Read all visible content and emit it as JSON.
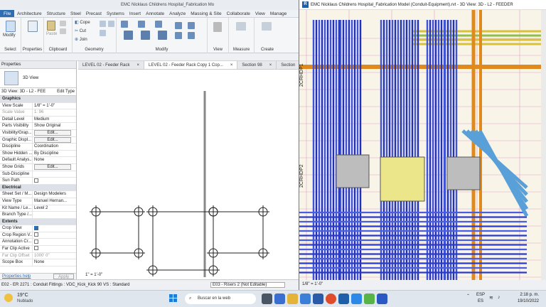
{
  "left_window": {
    "title": "EMC Nicklaus Childrens Hospital_Fabrication Mo",
    "menu": [
      "File",
      "Architecture",
      "Structure",
      "Steel",
      "Precast",
      "Systems",
      "Insert",
      "Annotate",
      "Analyze",
      "Massing & Site",
      "Collaborate",
      "View",
      "Manage"
    ],
    "ribbon": {
      "modify": "Modify",
      "paste": "Paste",
      "cope": "Cope",
      "cut": "Cut",
      "join": "Join",
      "groups": [
        "Select",
        "Properties",
        "Clipboard",
        "Geometry",
        "Modify",
        "View",
        "Measure",
        "Create"
      ]
    },
    "tabs": [
      "LEVEL 02 - Feeder Rack",
      "LEVEL 02 - Feeder Rack Copy 1 Cop...",
      "Section 98",
      "Section"
    ],
    "properties": {
      "header": "Properties",
      "type_name": "3D View",
      "selector": "3D View: 3D - L2 - FEE",
      "edit_type": "Edit Type",
      "rows": [
        {
          "k": "Graphics",
          "v": "",
          "section": true
        },
        {
          "k": "View Scale",
          "v": "1/8\" = 1'-0\""
        },
        {
          "k": "Scale Value",
          "v": "1: 96",
          "dim": true
        },
        {
          "k": "Detail Level",
          "v": "Medium"
        },
        {
          "k": "Parts Visibility",
          "v": "Show Original"
        },
        {
          "k": "Visibility/Grap...",
          "v": "Edit...",
          "btn": true
        },
        {
          "k": "Graphic Displ...",
          "v": "Edit...",
          "btn": true
        },
        {
          "k": "Discipline",
          "v": "Coordination"
        },
        {
          "k": "Show Hidden ...",
          "v": "By Discipline"
        },
        {
          "k": "Default Analys...",
          "v": "None"
        },
        {
          "k": "Show Grids",
          "v": "Edit...",
          "btn": true
        },
        {
          "k": "Sub-Discipline",
          "v": ""
        },
        {
          "k": "Sun Path",
          "v": "",
          "cb": false
        },
        {
          "k": "Electrical",
          "v": "",
          "section": true
        },
        {
          "k": "Sheet Set / M...",
          "v": "Design Modelers"
        },
        {
          "k": "View Type",
          "v": "Manuel Hernan..."
        },
        {
          "k": "Kit Name / Le...",
          "v": "Level 2"
        },
        {
          "k": "Branch Type /...",
          "v": ""
        },
        {
          "k": "Extents",
          "v": "",
          "section": true
        },
        {
          "k": "Crop View",
          "v": "",
          "cb": true
        },
        {
          "k": "Crop Region V...",
          "v": "",
          "cb": false
        },
        {
          "k": "Annotation Cr...",
          "v": "",
          "cb": false
        },
        {
          "k": "Far Clip Active",
          "v": "",
          "cb": false
        },
        {
          "k": "Far Clip Offset",
          "v": "1000' 0\"",
          "dim": true
        },
        {
          "k": "Scope Box",
          "v": "None"
        }
      ],
      "help": "Properties help",
      "apply": "Apply"
    },
    "canvas_scale": "1\" = 1'-0\"",
    "status": "E02 - ER 2271 : Conduit Fittings : VDC_Kick_Kick 90 VS : Standard"
  },
  "right_window": {
    "title": "EMC Nicklaus Childrens Hospital_Fabrication Model (Conduit-Equipment).rvt - 3D View: 3D - L2 - FEEDER",
    "scale": "1/8\" = 1'-0\"",
    "workset": "E03 - Risers 2 (Not Editable)",
    "labels": [
      "2CRHDP1",
      "2CRHDP2"
    ]
  },
  "taskbar": {
    "weather_temp": "19°C",
    "weather_desc": "Nublado",
    "search": "Buscar en la web",
    "lang1": "ESP",
    "lang2": "ES",
    "time": "2:18 p. m.",
    "date": "19/10/2022"
  }
}
